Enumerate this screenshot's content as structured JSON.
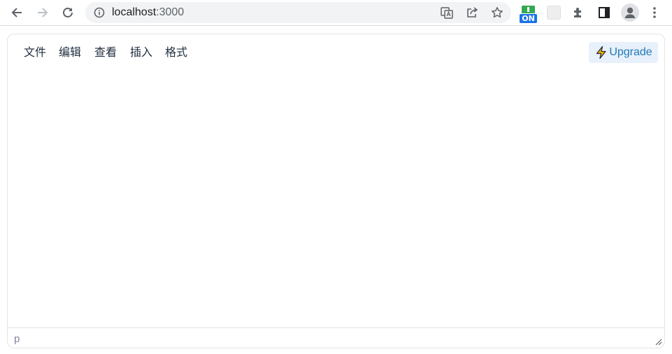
{
  "browser": {
    "url_host": "localhost",
    "url_port": ":3000",
    "icons": {
      "back": "arrow-left-icon",
      "forward": "arrow-right-icon",
      "reload": "reload-icon",
      "info": "info-circle-icon",
      "translate": "translate-icon",
      "share": "share-icon",
      "bookmark": "star-icon",
      "extension_on": "extension-on-icon",
      "extension_gray": "extension-icon",
      "extensions": "puzzle-icon",
      "side_panel": "side-panel-icon",
      "profile": "profile-icon",
      "menu": "kebab-menu-icon"
    },
    "extension_badge": "ON"
  },
  "editor": {
    "menu": [
      "文件",
      "编辑",
      "查看",
      "插入",
      "格式"
    ],
    "upgrade_label": "Upgrade",
    "status_path": "p",
    "colors": {
      "menu_text": "#222f3e",
      "upgrade_bg": "#e8f0fb",
      "upgrade_text": "#207ab7",
      "upgrade_icon": "#f5b301"
    }
  }
}
